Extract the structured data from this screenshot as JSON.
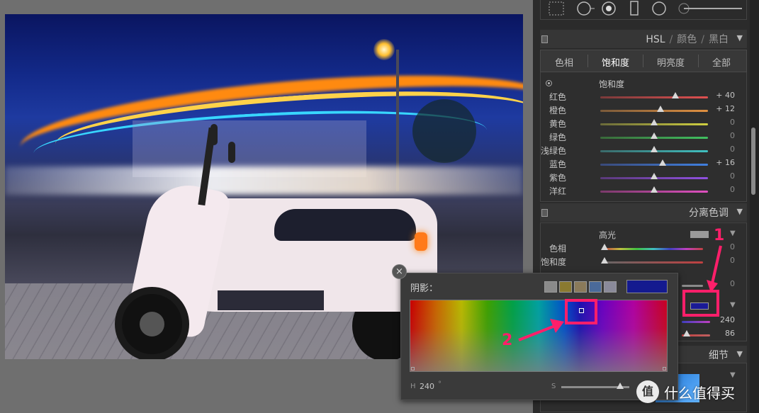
{
  "toolbar": {
    "icons": [
      "grid-icon",
      "circle-arrow-icon",
      "dot-circle-icon",
      "rectangle-icon",
      "circle-icon",
      "slider-icon"
    ]
  },
  "hsl_header": {
    "hsl": "HSL",
    "color": "颜色",
    "bw": "黑白"
  },
  "tabs": [
    {
      "label": "色相"
    },
    {
      "label": "饱和度"
    },
    {
      "label": "明亮度"
    },
    {
      "label": "全部"
    }
  ],
  "saturation": {
    "heading": "饱和度",
    "rows": [
      {
        "label": "红色",
        "value": "+ 40",
        "level": 0.7,
        "track": "linear-gradient(90deg,#7a3a3a,#e05050)"
      },
      {
        "label": "橙色",
        "value": "+ 12",
        "level": 0.56,
        "track": "linear-gradient(90deg,#7a5a3a,#e09040)"
      },
      {
        "label": "黄色",
        "value": "0",
        "level": 0.5,
        "track": "linear-gradient(90deg,#6a6a3a,#d0d040)"
      },
      {
        "label": "绿色",
        "value": "0",
        "level": 0.5,
        "track": "linear-gradient(90deg,#3a6a3a,#40c060)"
      },
      {
        "label": "浅绿色",
        "value": "0",
        "level": 0.5,
        "track": "linear-gradient(90deg,#3a6a6a,#40c0c0)"
      },
      {
        "label": "蓝色",
        "value": "+ 16",
        "level": 0.58,
        "track": "linear-gradient(90deg,#3a4a7a,#4080e0)"
      },
      {
        "label": "紫色",
        "value": "0",
        "level": 0.5,
        "track": "linear-gradient(90deg,#5a3a7a,#9050e0)"
      },
      {
        "label": "洋红",
        "value": "0",
        "level": 0.5,
        "track": "linear-gradient(90deg,#7a3a6a,#e050c0)"
      }
    ]
  },
  "split_toning": {
    "title": "分离色调",
    "highlights": {
      "label": "高光",
      "swatch": "#9a9a9a",
      "hue_label": "色相",
      "hue_value": "0",
      "sat_label": "饱和度",
      "sat_value": "0"
    },
    "balance_value": "0",
    "shadows": {
      "swatch": "#1a1a96",
      "hue_value": "240",
      "sat_value": "86"
    }
  },
  "detail": {
    "title": "细节"
  },
  "picker": {
    "close": "×",
    "title": "阴影：",
    "presets": [
      "#8a8a8a",
      "#8a7a30",
      "#8a7a5a",
      "#4a6a9a",
      "#8a8a9a"
    ],
    "current_color": "#141a8f",
    "h_label": "H",
    "h_value": "240",
    "h_unit": "°",
    "s_label": "S",
    "s_level": 0.86
  },
  "annotations": {
    "one": "1",
    "two": "2"
  },
  "watermark": {
    "logo": "值",
    "text": "什么值得买"
  }
}
